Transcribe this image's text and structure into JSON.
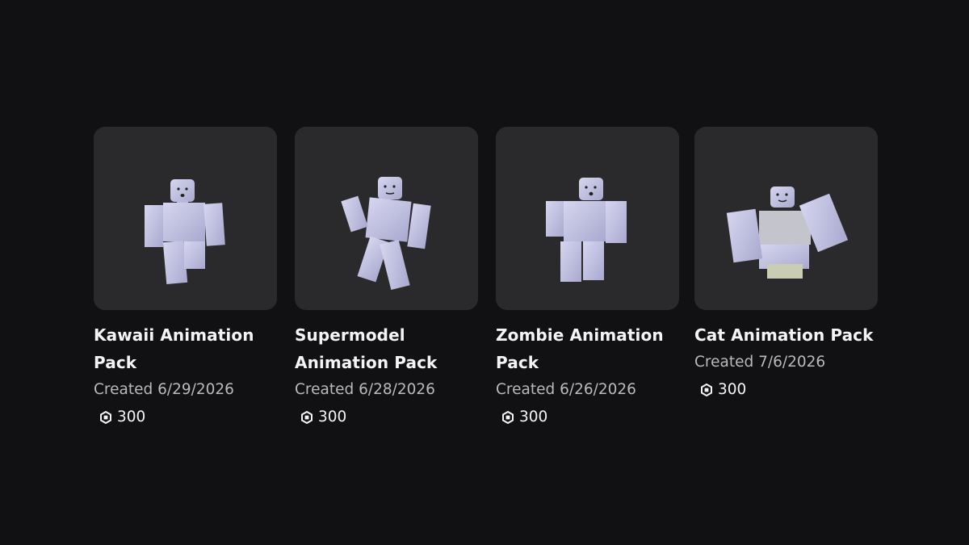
{
  "items": [
    {
      "name": "Kawaii Animation Pack",
      "title_lines": [
        "Kawaii Animation",
        "Pack"
      ],
      "created": "Created 6/29/2026",
      "price": "300",
      "thumbnail": "avatar-kawaii-pose"
    },
    {
      "name": "Supermodel Animation Pack",
      "title_lines": [
        "Supermodel",
        "Animation Pack"
      ],
      "created": "Created 6/28/2026",
      "price": "300",
      "thumbnail": "avatar-supermodel-pose"
    },
    {
      "name": "Zombie Animation Pack",
      "title_lines": [
        "Zombie Animation",
        "Pack"
      ],
      "created": "Created 6/26/2026",
      "price": "300",
      "thumbnail": "avatar-zombie-pose"
    },
    {
      "name": "Cat Animation Pack",
      "title_lines": [
        "Cat Animation Pack"
      ],
      "created": "Created 7/6/2026",
      "price": "300",
      "thumbnail": "avatar-cat-pose"
    }
  ],
  "currency_icon": "robux-icon",
  "colors": {
    "background": "#111114",
    "card_thumb": "#2a2a2d",
    "avatar": "#c9c9e6",
    "title": "#f4f4f6",
    "subtext": "#b9b9be"
  }
}
